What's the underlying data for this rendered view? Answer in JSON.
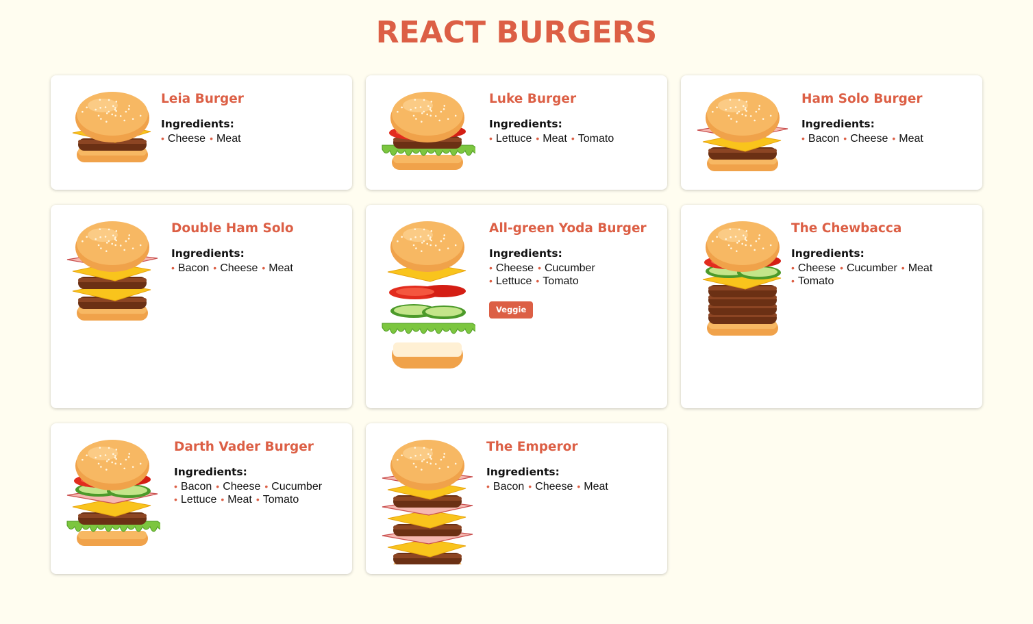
{
  "page": {
    "title": "REACT BURGERS"
  },
  "common": {
    "ingredients_label": "Ingredients:"
  },
  "colors": {
    "accent": "#dc5f45",
    "background": "#fffdf0"
  },
  "burgers": [
    {
      "name": "Leia Burger",
      "ingredients": [
        "Cheese",
        "Meat"
      ],
      "badge": ""
    },
    {
      "name": "Luke Burger",
      "ingredients": [
        "Lettuce",
        "Meat",
        "Tomato"
      ],
      "badge": ""
    },
    {
      "name": "Ham Solo Burger",
      "ingredients": [
        "Bacon",
        "Cheese",
        "Meat"
      ],
      "badge": ""
    },
    {
      "name": "Double Ham Solo",
      "ingredients": [
        "Bacon",
        "Cheese",
        "Meat"
      ],
      "badge": ""
    },
    {
      "name": "All-green Yoda Burger",
      "ingredients": [
        "Cheese",
        "Cucumber",
        "Lettuce",
        "Tomato"
      ],
      "badge": "Veggie"
    },
    {
      "name": "The Chewbacca",
      "ingredients": [
        "Cheese",
        "Cucumber",
        "Meat",
        "Tomato"
      ],
      "badge": ""
    },
    {
      "name": "Darth Vader Burger",
      "ingredients": [
        "Bacon",
        "Cheese",
        "Cucumber",
        "Lettuce",
        "Meat",
        "Tomato"
      ],
      "badge": ""
    },
    {
      "name": "The Emperor",
      "ingredients": [
        "Bacon",
        "Cheese",
        "Meat"
      ],
      "badge": ""
    }
  ]
}
